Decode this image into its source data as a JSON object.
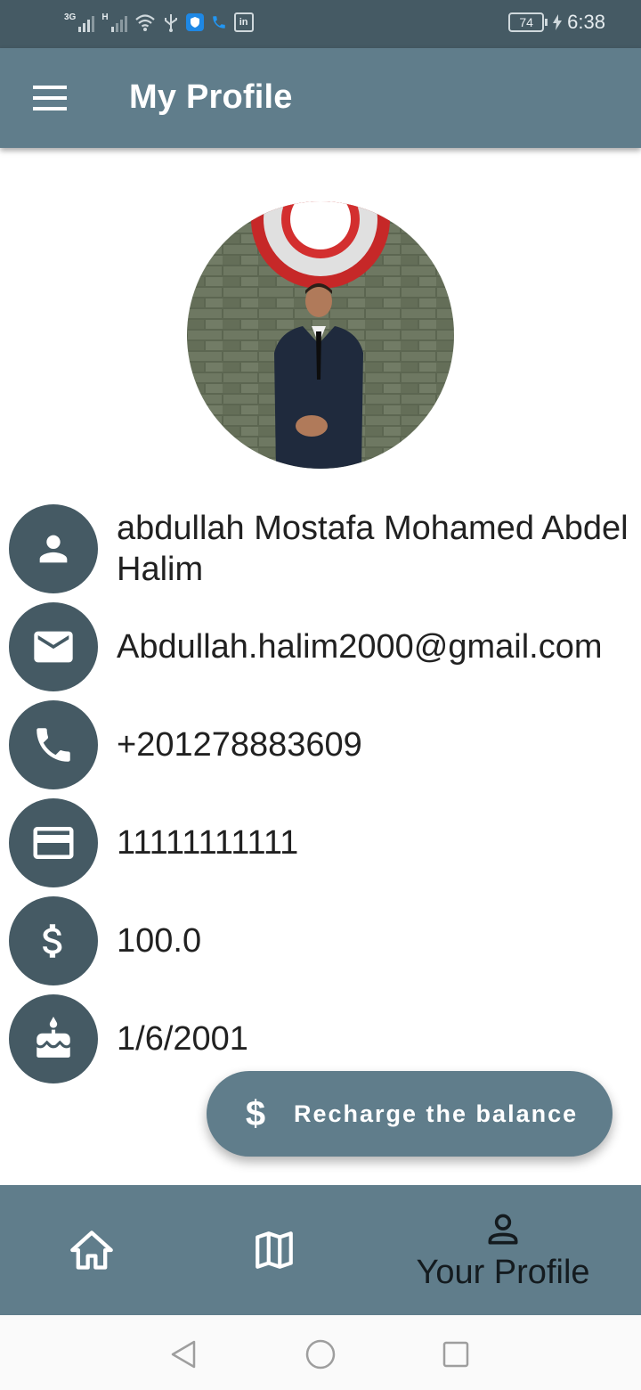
{
  "status_bar": {
    "signal1_label": "3G",
    "signal2_label": "H",
    "battery_level": "74",
    "time": "6:38"
  },
  "app_bar": {
    "title": "My Profile",
    "menu_icon": "menu-icon"
  },
  "profile": {
    "avatar_icon": "profile-photo",
    "rows": [
      {
        "icon": "person-icon",
        "value": "abdullah Mostafa Mohamed Abdel Halim"
      },
      {
        "icon": "mail-icon",
        "value": "Abdullah.halim2000@gmail.com"
      },
      {
        "icon": "phone-icon",
        "value": "+201278883609"
      },
      {
        "icon": "credit-card-icon",
        "value": "11111111111"
      },
      {
        "icon": "dollar-icon",
        "value": "100.0"
      },
      {
        "icon": "cake-icon",
        "value": "1/6/2001"
      }
    ]
  },
  "actions": {
    "recharge_icon": "$",
    "recharge_label": "Recharge the balance"
  },
  "bottom_nav": {
    "items": [
      {
        "icon": "home-icon",
        "label": ""
      },
      {
        "icon": "map-icon",
        "label": ""
      },
      {
        "icon": "person-outline-icon",
        "label": "Your Profile"
      }
    ]
  },
  "colors": {
    "status_bar": "#455a64",
    "app_bar": "#607d8b",
    "icon_circle": "#455a64",
    "bottom_nav": "#607d8b",
    "system_nav": "#fafafa"
  }
}
